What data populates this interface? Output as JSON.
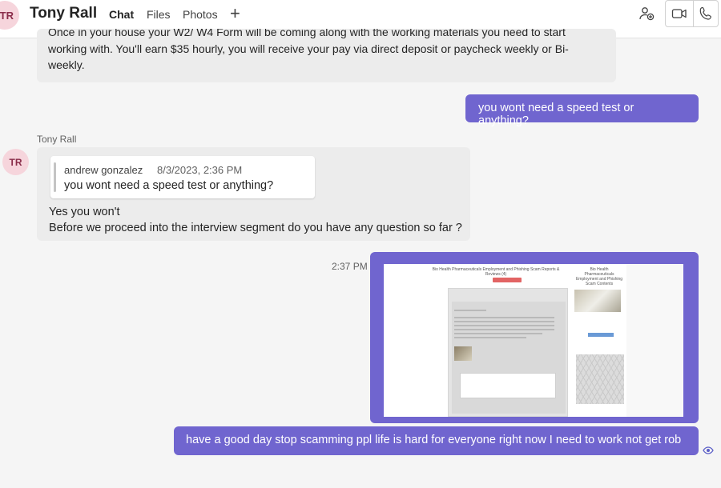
{
  "header": {
    "avatar_initials": "TR",
    "title": "Tony Rall",
    "tabs": [
      {
        "label": "Chat",
        "active": true
      },
      {
        "label": "Files",
        "active": false
      },
      {
        "label": "Photos",
        "active": false
      }
    ],
    "add_tab_icon": "plus-icon",
    "icons": [
      "people-add-icon",
      "video-call-icon",
      "phone-call-icon"
    ]
  },
  "messages": {
    "first": {
      "line1": "Once in your house your W2/ W4 Form will be coming along with the working materials you need to start",
      "line2": "working with. You'll earn $35 hourly, you will receive your pay via direct deposit or paycheck weekly or Bi-",
      "line3": "weekly."
    },
    "sent_question": "you wont need a speed test or anything?",
    "reply": {
      "sender": "Tony Rall",
      "avatar_initials": "TR",
      "quote_author": "andrew gonzalez",
      "quote_time": "8/3/2023, 2:36 PM",
      "quote_text": "you wont need a speed test or anything?",
      "line1": "Yes you won't",
      "line2": "Before we proceed into the interview segment do you have any question so far ?"
    },
    "image_message": {
      "timestamp": "2:37 PM",
      "screenshot_title": "Bio Health Pharmaceuticals Employment and Phishing Scam Reports & Reviews (4)",
      "screenshot_side_title": "Bio Health Pharmaceuticals Employment and Phishing Scam Contents"
    },
    "last_message": "have a good day stop scamming ppl life is hard for everyone right now  I need to work not get rob",
    "read_receipt_icon": "eye-icon"
  },
  "colors": {
    "accent": "#5b5fc7",
    "sent_bubble": "#7065cf",
    "received_bubble": "#ececec",
    "avatar_bg": "#f6d5dc"
  }
}
